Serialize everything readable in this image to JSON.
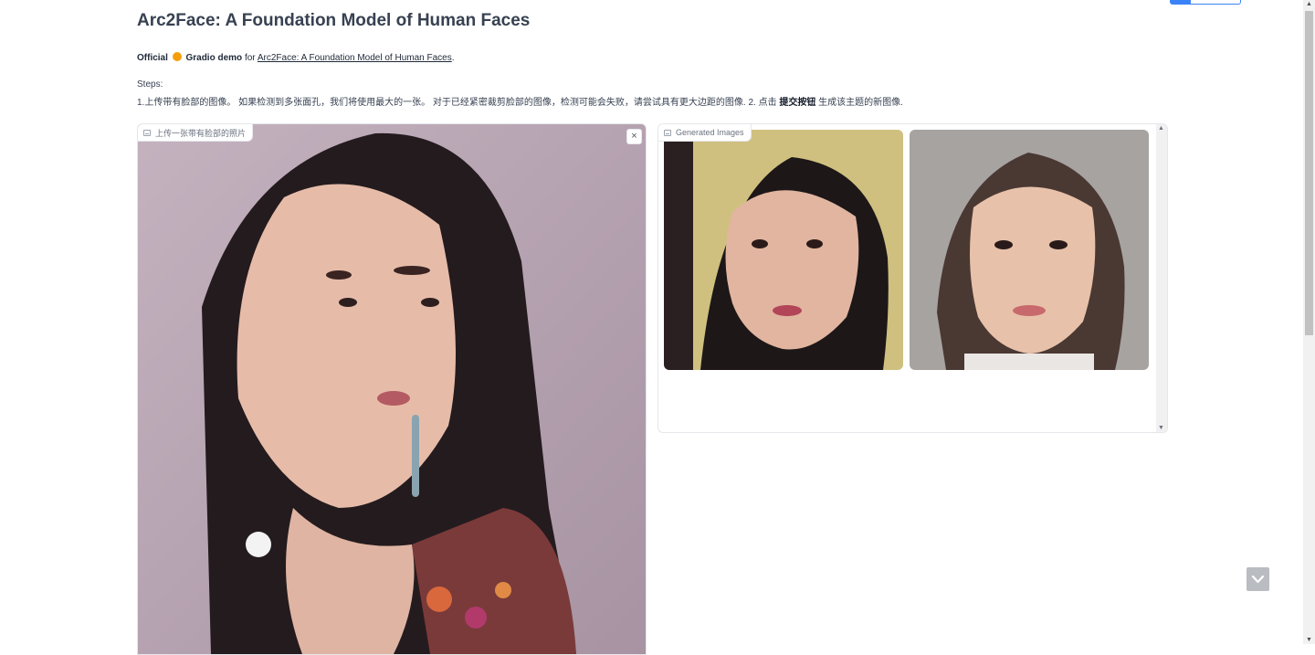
{
  "header": {
    "title": "Arc2Face: A Foundation Model of Human Faces",
    "official_prefix": "Official",
    "demo_text": "Gradio demo",
    "for_text": "for",
    "link_text": "Arc2Face: A Foundation Model of Human Faces",
    "period": "."
  },
  "steps": {
    "label": "Steps:",
    "step1": "1.上传带有脸部的图像。 如果检测到多张面孔，我们将使用最大的一张。 对于已经紧密裁剪脸部的图像，检测可能会失败，请尝试具有更大边距的图像. 2. 点击",
    "submit_word": "提交按钮",
    "step2": "生成该主题的新图像."
  },
  "input_panel": {
    "label": "上传一张带有脸部的照片",
    "close_symbol": "×"
  },
  "output_panel": {
    "label": "Generated Images"
  },
  "colors": {
    "accent": "#3b82f6",
    "border": "#e5e7eb"
  },
  "icons": {
    "image": "image-icon",
    "close": "close-icon",
    "scroll_down": "chevron-down-icon"
  }
}
